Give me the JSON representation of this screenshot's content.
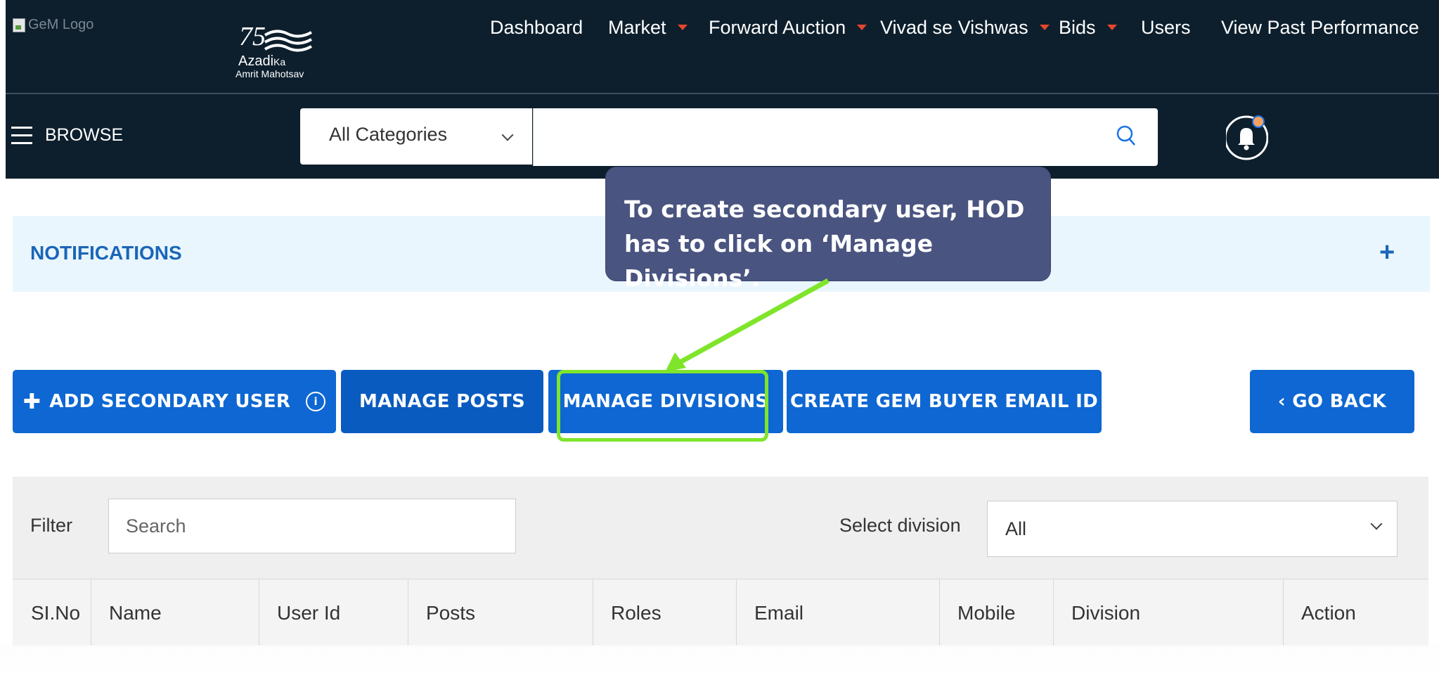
{
  "header": {
    "logo_alt": "GeM Logo",
    "azadi": {
      "number": "75",
      "line1": "Azadi",
      "line1_small": "Ka",
      "line2": "Amrit Mahotsav"
    },
    "nav": [
      {
        "label": "Dashboard",
        "dropdown": false
      },
      {
        "label": "Market",
        "dropdown": true
      },
      {
        "label": "Forward Auction",
        "dropdown": true
      },
      {
        "label": "Vivad se Vishwas",
        "dropdown": true
      },
      {
        "label": "Bids",
        "dropdown": true
      },
      {
        "label": "Users",
        "dropdown": false
      },
      {
        "label": "View Past Performance",
        "dropdown": false
      }
    ]
  },
  "browse_bar": {
    "browse_label": "BROWSE",
    "category_selected": "All Categories",
    "search_value": ""
  },
  "tooltip": {
    "text": "To create secondary user, HOD has to click on ‘Manage Divisions’."
  },
  "notifications": {
    "title": "NOTIFICATIONS",
    "expand": "+"
  },
  "buttons": {
    "add_secondary_user": "ADD SECONDARY USER",
    "info": "i",
    "manage_posts": "MANAGE POSTS",
    "manage_divisions": "MANAGE DIVISIONS",
    "create_email": "CREATE GEM BUYER EMAIL ID",
    "go_back": "‹ GO BACK"
  },
  "filter": {
    "label": "Filter",
    "search_placeholder": "Search",
    "division_label": "Select division",
    "division_selected": "All"
  },
  "table": {
    "columns": [
      "SI.No",
      "Name",
      "User Id",
      "Posts",
      "Roles",
      "Email",
      "Mobile",
      "Division",
      "Action"
    ]
  },
  "colors": {
    "header_bg": "#0d1f2d",
    "primary_button": "#0e67d2",
    "highlight": "#7fe52b",
    "tooltip_bg": "#4a5480",
    "notification_bg": "#eaf6fd",
    "nav_caret": "#e8452e"
  }
}
